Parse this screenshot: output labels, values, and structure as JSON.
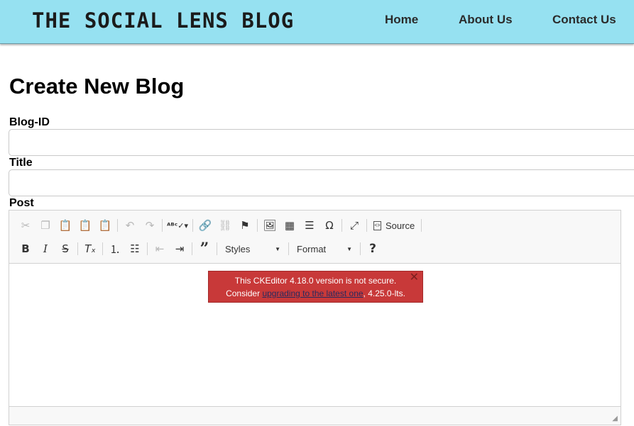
{
  "header": {
    "brand": "THE SOCIAL LENS BLOG",
    "nav": [
      {
        "label": "Home"
      },
      {
        "label": "About Us"
      },
      {
        "label": "Contact Us"
      }
    ],
    "background_color": "#96e1f1"
  },
  "form": {
    "page_title": "Create New Blog",
    "blog_id": {
      "label": "Blog-ID",
      "value": ""
    },
    "title": {
      "label": "Title",
      "value": ""
    },
    "post": {
      "label": "Post"
    }
  },
  "editor": {
    "toolbar": {
      "source_label": "Source",
      "styles_label": "Styles",
      "format_label": "Format",
      "help_label": "?"
    },
    "notice": {
      "line1": "This CKEditor 4.18.0 version is not secure.",
      "prefix": "Consider ",
      "link_text": "upgrading to the latest one",
      "suffix": ", 4.25.0-lts.",
      "close_label": "✕",
      "color": "#c83939"
    }
  }
}
